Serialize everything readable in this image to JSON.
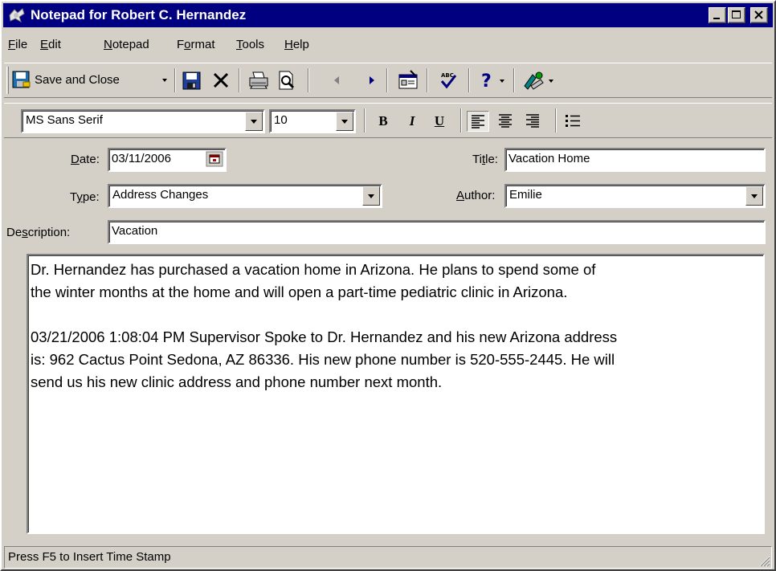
{
  "window": {
    "title": "Notepad for Robert C. Hernandez",
    "colors": {
      "titlebar": "#000080",
      "face": "#d4d0c8"
    }
  },
  "menu": [
    {
      "pre": "",
      "key": "F",
      "post": "ile"
    },
    {
      "pre": "",
      "key": "E",
      "post": "dit"
    },
    {
      "pre": "",
      "key": "N",
      "post": "otepad"
    },
    {
      "pre": "F",
      "key": "o",
      "post": "rmat"
    },
    {
      "pre": "",
      "key": "T",
      "post": "ools"
    },
    {
      "pre": "",
      "key": "H",
      "post": "elp"
    }
  ],
  "toolbar": {
    "save_close_label": "Save and Close",
    "icons": [
      "save-close-icon",
      "save-icon",
      "delete-icon",
      "print-icon",
      "print-preview-icon",
      "previous-icon",
      "next-icon",
      "properties-icon",
      "spellcheck-icon",
      "help-icon",
      "tools-icon"
    ]
  },
  "format": {
    "font_name": "MS Sans Serif",
    "font_size": "10",
    "bold": "B",
    "italic": "I",
    "underline": "U",
    "alignment": "left"
  },
  "fields": {
    "date": {
      "label_pre": "",
      "label_key": "D",
      "label_post": "ate:",
      "value": "03/11/2006"
    },
    "title": {
      "label_pre": "Ti",
      "label_key": "t",
      "label_post": "le:",
      "value": "Vacation Home"
    },
    "type": {
      "label_pre": "T",
      "label_key": "y",
      "label_post": "pe:",
      "value": "Address Changes"
    },
    "author": {
      "label_pre": "",
      "label_key": "A",
      "label_post": "uthor:",
      "value": "Emilie"
    },
    "description": {
      "label_pre": "De",
      "label_key": "s",
      "label_post": "cription:",
      "value": "Vacation"
    }
  },
  "notes": {
    "lines": [
      [
        "Dr. Hernandez has purchased a vacation home in Arizona.  He plans to spend some of",
        "the winter months at the home and will open a part-time pediatric clinic in Arizona."
      ],
      [
        "03/21/2006 1:08:04 PM Supervisor  Spoke to Dr. Hernandez and his new Arizona address",
        "is:  962 Cactus Point  Sedona, AZ 86336.  His new phone number is 520-555-2445.  He will",
        "send us his new clinic address and phone number next month."
      ]
    ]
  },
  "status": {
    "text": "Press F5 to Insert Time Stamp"
  }
}
